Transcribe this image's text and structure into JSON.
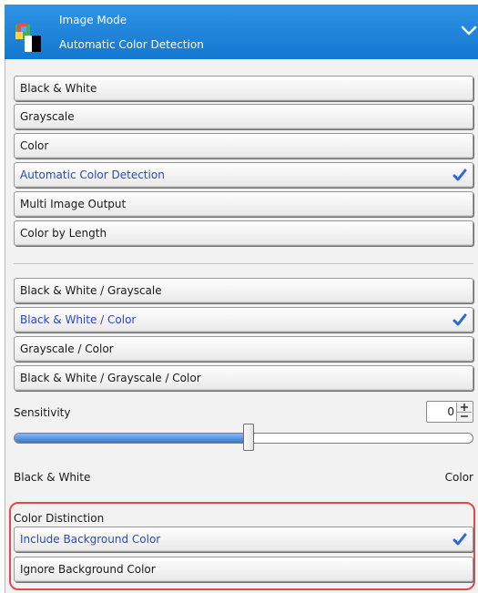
{
  "header": {
    "title": "Image Mode",
    "subtitle": "Automatic Color Detection"
  },
  "mode_options": [
    {
      "label": "Black & White",
      "selected": false
    },
    {
      "label": "Grayscale",
      "selected": false
    },
    {
      "label": "Color",
      "selected": false
    },
    {
      "label": "Automatic Color Detection",
      "selected": true
    },
    {
      "label": "Multi Image Output",
      "selected": false
    },
    {
      "label": "Color by Length",
      "selected": false
    }
  ],
  "detection_options": [
    {
      "label": "Black & White / Grayscale",
      "selected": false
    },
    {
      "label": "Black & White / Color",
      "selected": true
    },
    {
      "label": "Grayscale / Color",
      "selected": false
    },
    {
      "label": "Black & White / Grayscale / Color",
      "selected": false
    }
  ],
  "sensitivity": {
    "label": "Sensitivity",
    "value": "0",
    "slider_fraction": 0.51,
    "left_label": "Black & White",
    "right_label": "Color"
  },
  "color_distinction": {
    "label": "Color Distinction",
    "options": [
      {
        "label": "Include Background Color",
        "selected": true
      },
      {
        "label": "Ignore Background Color",
        "selected": false
      }
    ]
  },
  "colors": {
    "header_blue": "#1a7fd8",
    "selected_text": "#2a47c9",
    "check_blue": "#2a6ad8",
    "highlight_border": "#e24a4a"
  }
}
